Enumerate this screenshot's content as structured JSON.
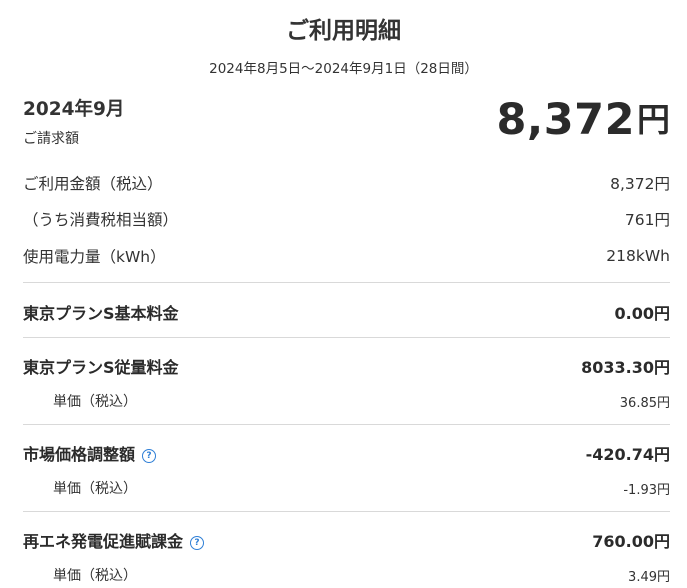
{
  "title": "ご利用明細",
  "period": "2024年8月5日～2024年9月1日（28日間）",
  "summary": {
    "month": "2024年9月",
    "billing_label": "ご請求額",
    "total_amount": "8,372",
    "total_unit": "円"
  },
  "details": {
    "usage_amount": {
      "label": "ご利用金額（税込）",
      "value": "8,372円"
    },
    "consumption_tax": {
      "label": "（うち消費税相当額）",
      "value": "761円"
    },
    "power_usage": {
      "label": "使用電力量（kWh）",
      "value": "218kWh"
    }
  },
  "charges": {
    "basic": {
      "label": "東京プランS基本料金",
      "value": "0.00円"
    },
    "metered": {
      "label": "東京プランS従量料金",
      "value": "8033.30円",
      "unit_price_label": "単価（税込）",
      "unit_price_value": "36.85円"
    },
    "market_adjustment": {
      "label": "市場価格調整額",
      "value": "-420.74円",
      "unit_price_label": "単価（税込）",
      "unit_price_value": "-1.93円",
      "help_icon": "question-circle-icon"
    },
    "renewable_surcharge": {
      "label": "再エネ発電促進賦課金",
      "value": "760.00円",
      "unit_price_label": "単価（税込）",
      "unit_price_value": "3.49円",
      "help_icon": "question-circle-icon"
    }
  },
  "colors": {
    "text": "#333333",
    "divider": "#d9d9d9",
    "help_icon": "#2f7fd6"
  }
}
